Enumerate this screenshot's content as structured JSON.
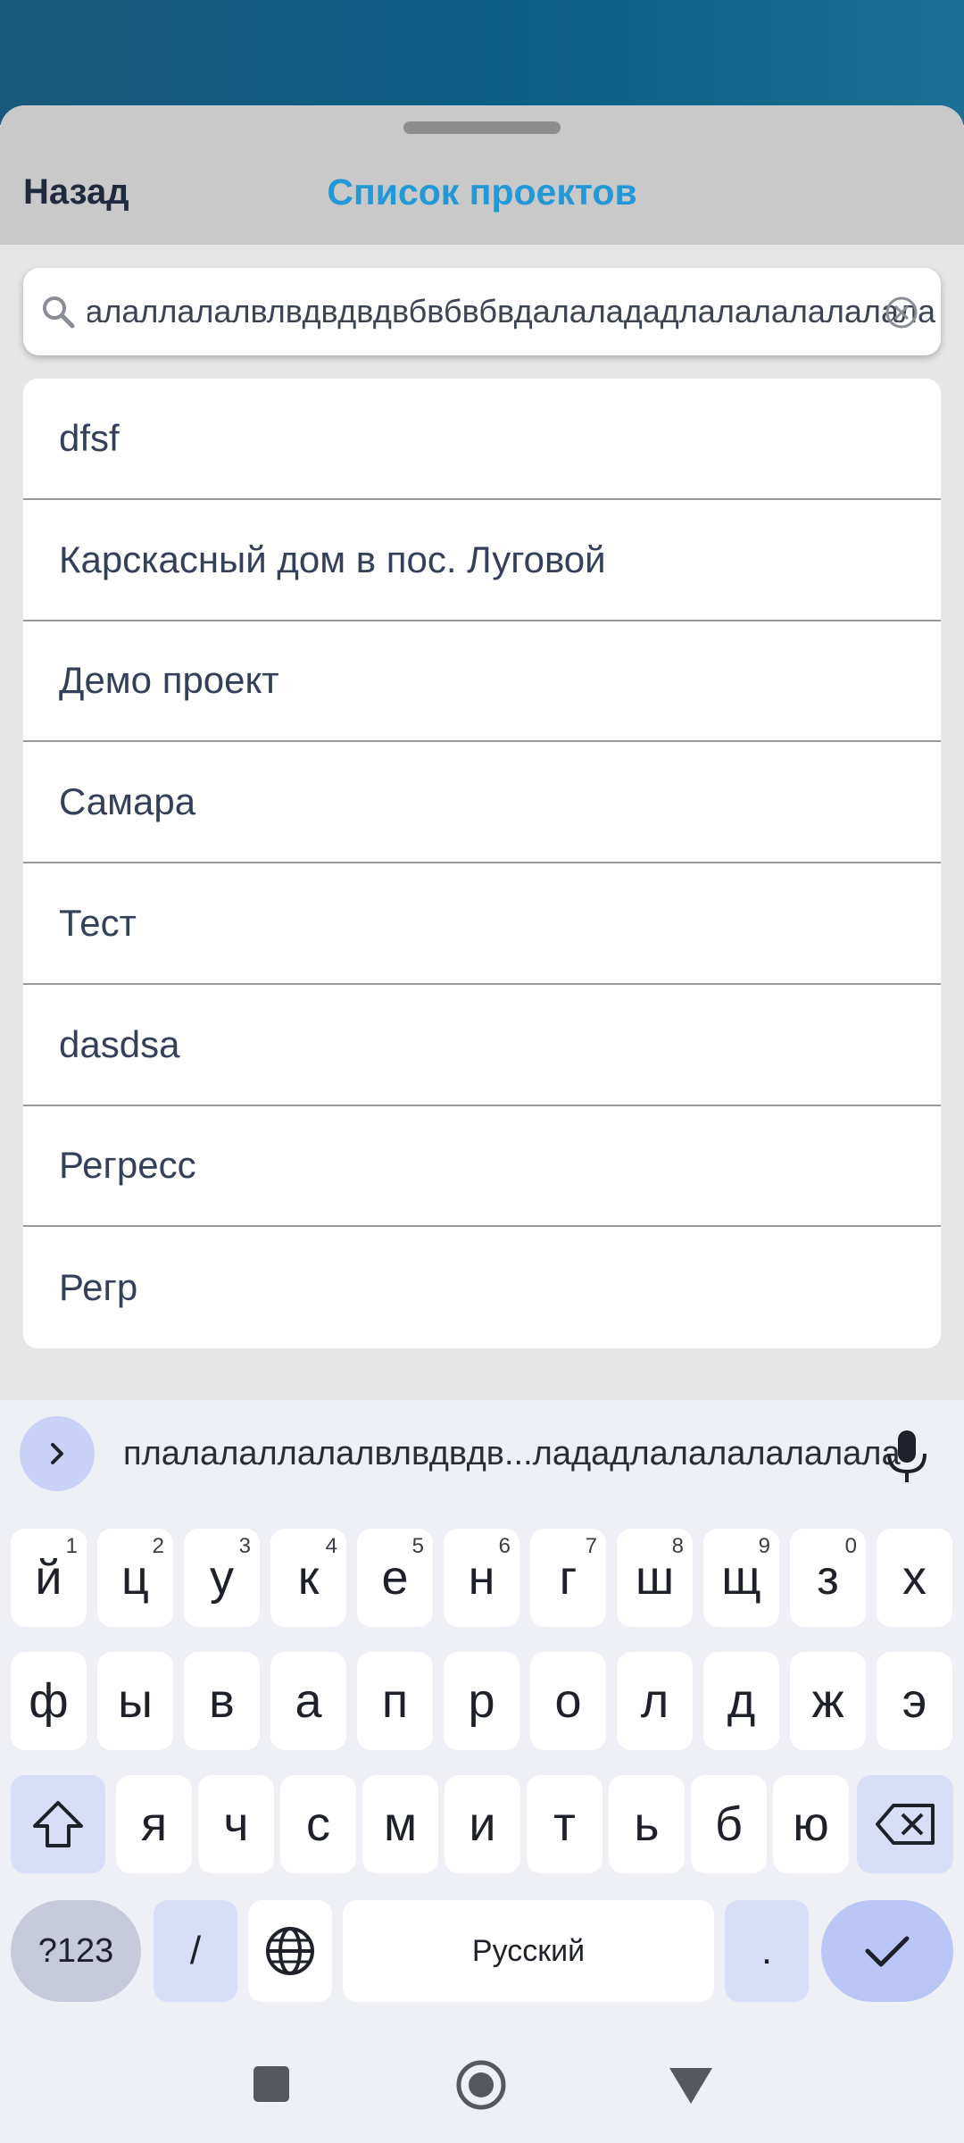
{
  "header": {
    "back_label": "Назад",
    "title": "Список проектов"
  },
  "search": {
    "value": "плалалаллалалвлвдвдвдвбвбвбвдалалададлалалалалалала"
  },
  "projects": [
    {
      "name": "dfsf"
    },
    {
      "name": "Карскасный дом в пос. Луговой"
    },
    {
      "name": "Демо проект"
    },
    {
      "name": "Самара"
    },
    {
      "name": "Тест"
    },
    {
      "name": "dasdsa"
    },
    {
      "name": "Регресс"
    },
    {
      "name": "Регр"
    }
  ],
  "keyboard": {
    "suggestion": "плалалаллалалвлвдвдв...лададлалалалалалала",
    "row1": [
      {
        "k": "й",
        "n": "1"
      },
      {
        "k": "ц",
        "n": "2"
      },
      {
        "k": "у",
        "n": "3"
      },
      {
        "k": "к",
        "n": "4"
      },
      {
        "k": "е",
        "n": "5"
      },
      {
        "k": "н",
        "n": "6"
      },
      {
        "k": "г",
        "n": "7"
      },
      {
        "k": "ш",
        "n": "8"
      },
      {
        "k": "щ",
        "n": "9"
      },
      {
        "k": "з",
        "n": "0"
      },
      {
        "k": "х",
        "n": ""
      }
    ],
    "row2": [
      "ф",
      "ы",
      "в",
      "а",
      "п",
      "р",
      "о",
      "л",
      "д",
      "ж",
      "э"
    ],
    "row3": [
      "я",
      "ч",
      "с",
      "м",
      "и",
      "т",
      "ь",
      "б",
      "ю"
    ],
    "sym_label": "?123",
    "slash_label": "/",
    "space_label": "Русский",
    "period_label": "."
  },
  "icons": {
    "search": "search-icon",
    "clear": "clear-icon",
    "expand": "chevron-right-icon",
    "mic": "mic-icon",
    "shift": "shift-icon",
    "backspace": "backspace-icon",
    "globe": "globe-icon",
    "enter": "checkmark-icon",
    "nav_recent": "square-icon",
    "nav_home": "circle-icon",
    "nav_back": "triangle-icon"
  },
  "colors": {
    "accent": "#2398d6",
    "header_bg": "#c9c9c9",
    "keyboard_bg": "#eff0f6",
    "key_dark": "#d9def8"
  }
}
